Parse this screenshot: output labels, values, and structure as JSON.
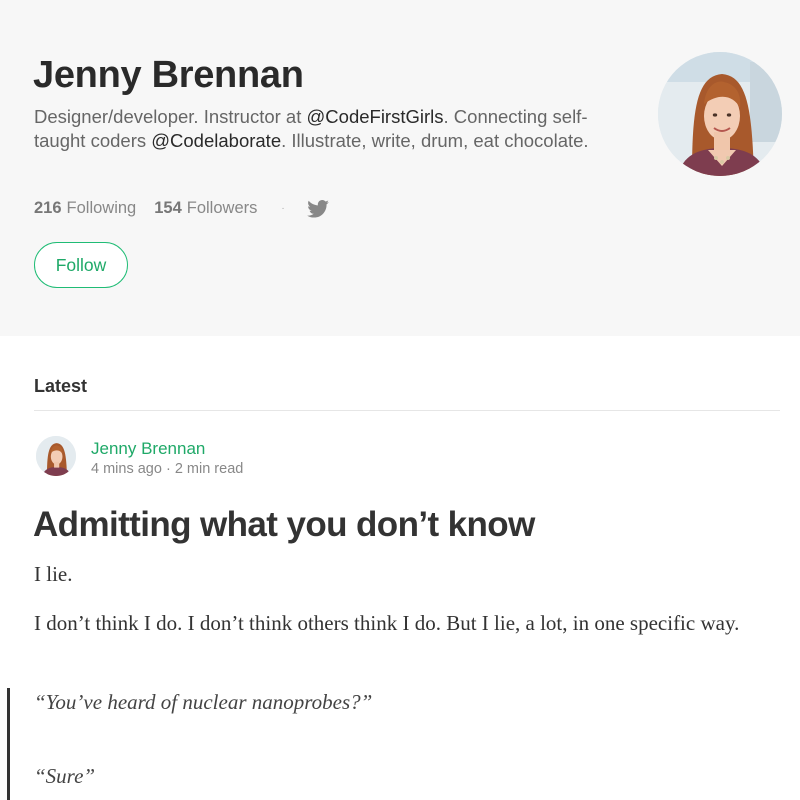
{
  "profile": {
    "name": "Jenny Brennan",
    "bio": {
      "part1": "Designer/developer. Instructor at ",
      "handle1": "@CodeFirstGirls",
      "part2": ". Connecting self-taught coders ",
      "handle2": "@Codelaborate",
      "part3": ". Illustrate, write, drum, eat chocolate."
    },
    "following_count": "216",
    "following_label": "Following",
    "followers_count": "154",
    "followers_label": "Followers",
    "separator": "·",
    "twitter_icon": "twitter-icon",
    "follow_label": "Follow",
    "accent_color": "#1fbc75"
  },
  "latest": {
    "label": "Latest"
  },
  "post": {
    "author": "Jenny Brennan",
    "meta": "4 mins ago · 2 min read",
    "title": "Admitting what you don’t know",
    "paragraphs": [
      "I lie.",
      "I don’t think I do. I don’t think others think I do. But I lie, a lot, in one specific way."
    ],
    "quotes": [
      "“You’ve heard of nuclear nanoprobes?”",
      "“Sure”"
    ]
  }
}
